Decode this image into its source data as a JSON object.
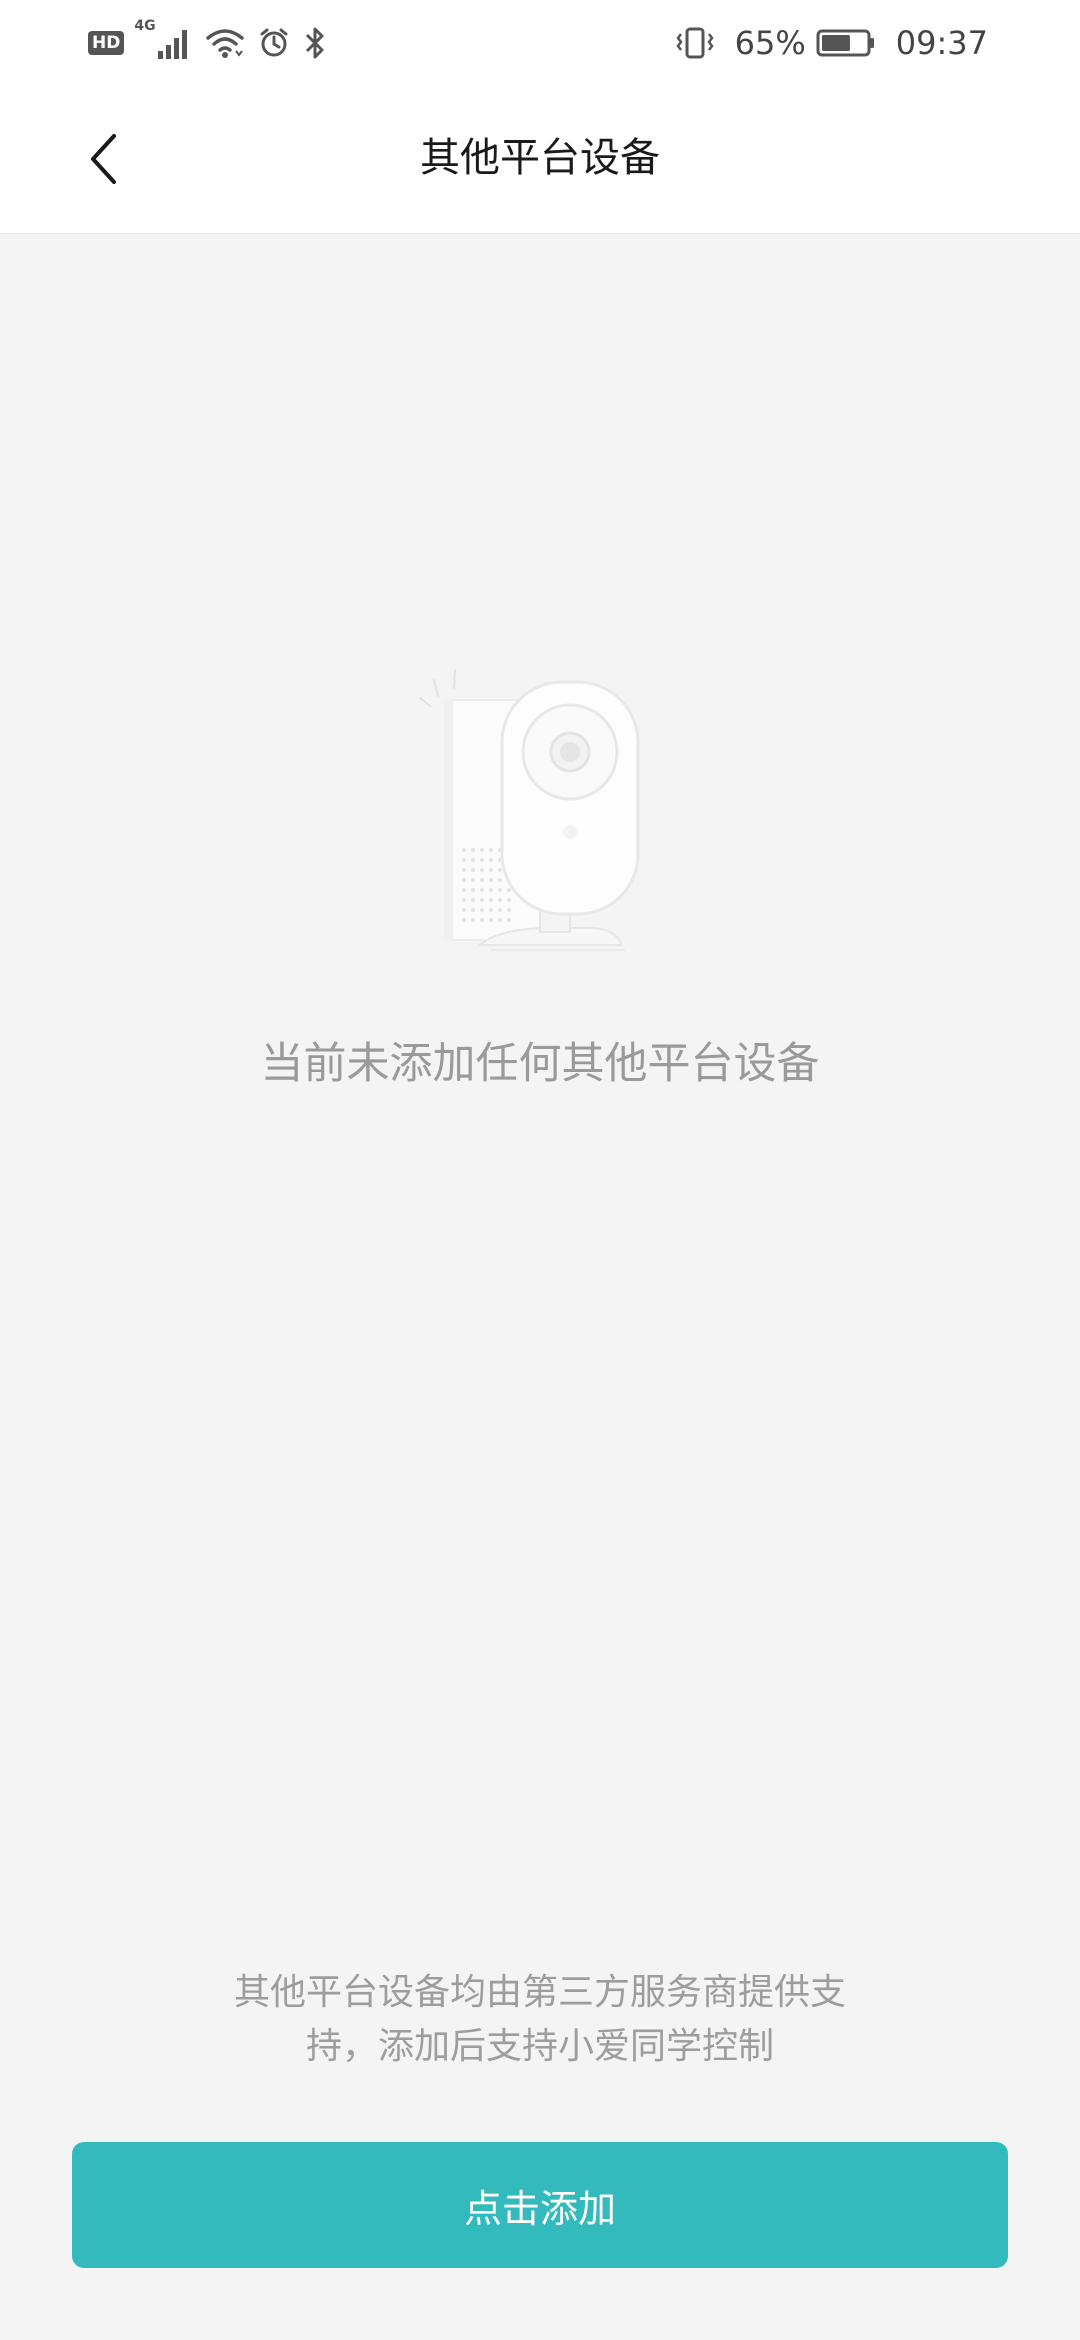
{
  "status_bar": {
    "hd_label": "HD",
    "network_label": "4G",
    "battery_percent": "65%",
    "time": "09:37",
    "icons": [
      "hd-badge",
      "signal-icon",
      "wifi-icon",
      "alarm-icon",
      "bluetooth-icon",
      "vibrate-icon",
      "battery-icon"
    ],
    "battery_level": 0.65
  },
  "header": {
    "title": "其他平台设备",
    "back_icon": "chevron-left-icon"
  },
  "empty_state": {
    "illustration": "camera-illustration",
    "message": "当前未添加任何其他平台设备"
  },
  "footer": {
    "note_line1": "其他平台设备均由第三方服务商提供支",
    "note_line2": "持，添加后支持小爱同学控制",
    "button_label": "点击添加"
  },
  "colors": {
    "accent": "#33babd",
    "background": "#f4f4f4",
    "muted_text": "#9a9a9a"
  }
}
